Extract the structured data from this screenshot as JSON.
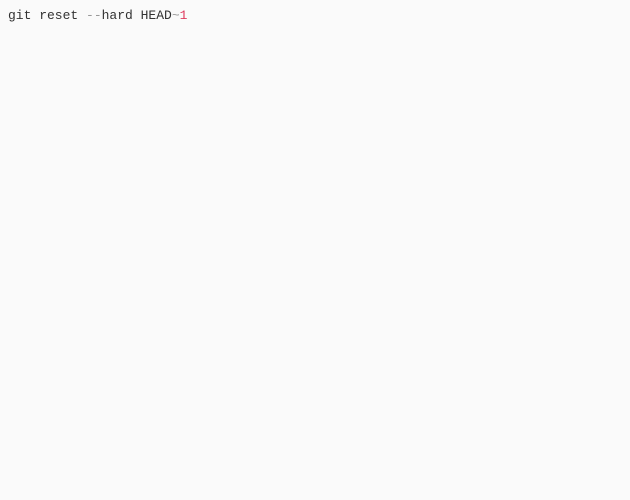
{
  "code": {
    "t1": "git reset ",
    "t2": "--",
    "t3": "hard HEAD",
    "t4": "~",
    "t5": "1"
  }
}
